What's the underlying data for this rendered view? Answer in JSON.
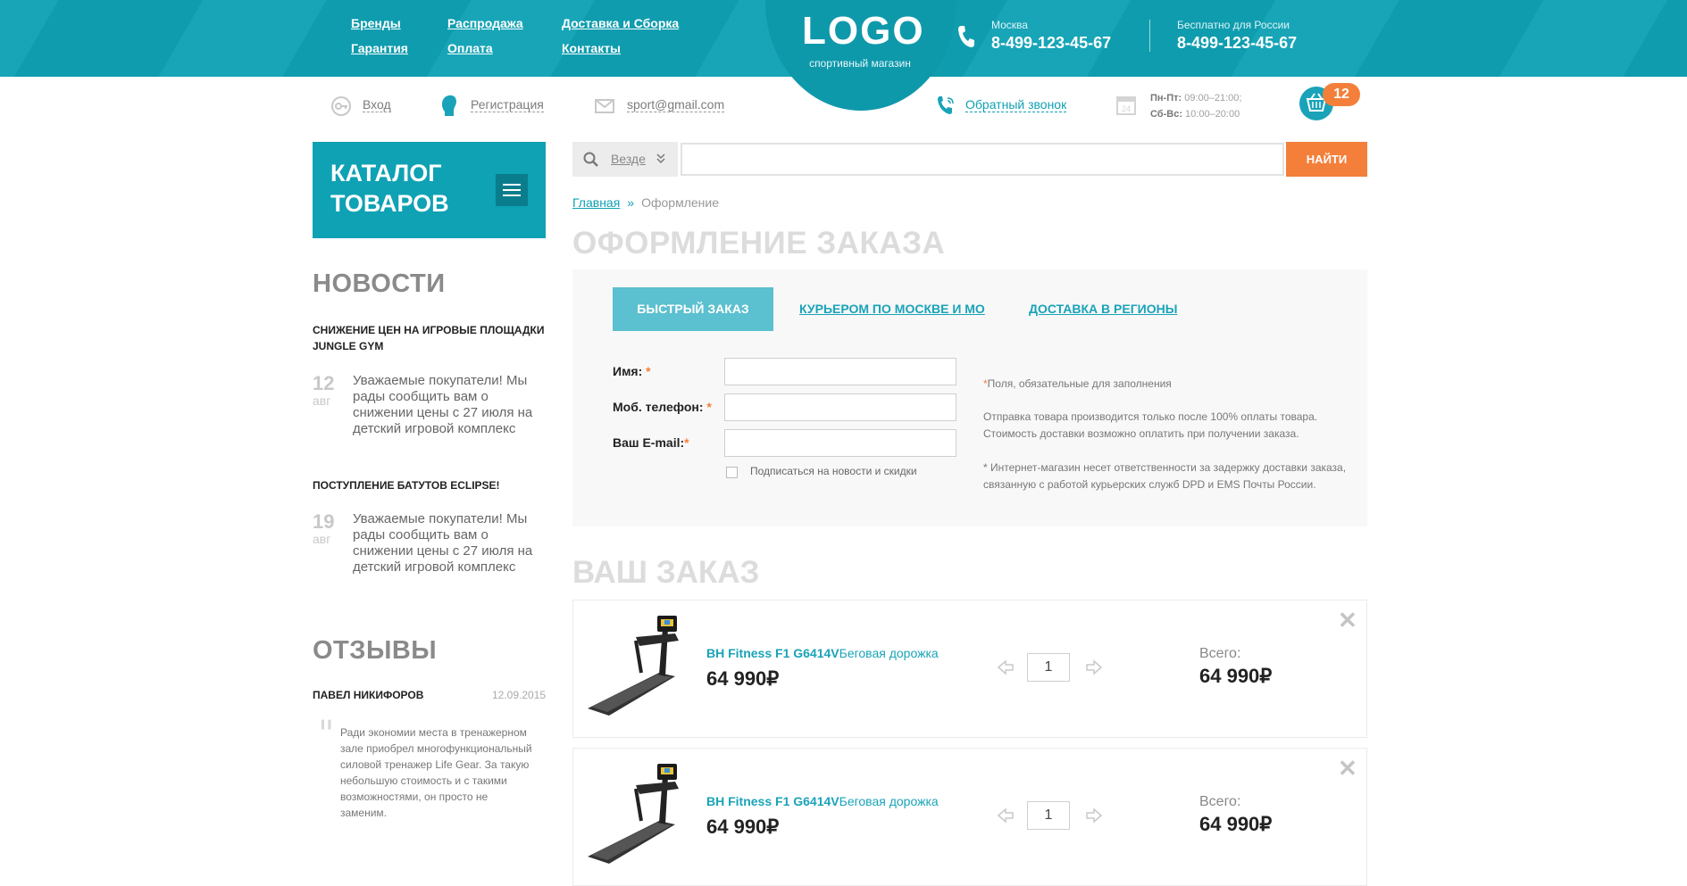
{
  "header": {
    "nav": [
      "Бренды",
      "Распродажа",
      "Доставка и Сборка",
      "Гарантия",
      "Оплата",
      "Контакты"
    ],
    "logo": "LOGO",
    "logo_sub": "спортивный магазин",
    "city1": "Москва",
    "phone1": "8-499-123-45-67",
    "city2": "Бесплатно для России",
    "phone2": "8-499-123-45-67"
  },
  "subheader": {
    "login": "Вход",
    "register": "Регистрация",
    "email": "sport@gmail.com",
    "callback": "Обратный звонок",
    "hours_wd_label": "Пн-Пт:",
    "hours_wd": "09:00–21:00;",
    "hours_we_label": "Сб-Вс:",
    "hours_we": "10:00–20:00",
    "cart_count": "12"
  },
  "catalog": {
    "title": "КАТАЛОГ ТОВАРОВ"
  },
  "sidebar": {
    "news_heading": "НОВОСТИ",
    "news": [
      {
        "title": "СНИЖЕНИЕ ЦЕН НА ИГРОВЫЕ ПЛОЩАДКИ JUNGLE GYM",
        "day": "12",
        "month": "авг",
        "text": "Уважаемые покупатели! Мы рады сообщить вам о снижении цены с 27 июля на детский игровой комплекс"
      },
      {
        "title": "ПОСТУПЛЕНИЕ БАТУТОВ ECLIPSE!",
        "day": "19",
        "month": "авг",
        "text": "Уважаемые покупатели! Мы рады сообщить вам о снижении цены с 27 июля на детский игровой комплекс"
      }
    ],
    "reviews_heading": "ОТЗЫВЫ",
    "review": {
      "name": "ПАВЕЛ НИКИФОРОВ",
      "date": "12.09.2015",
      "text": "Ради экономии места в тренажерном зале приобрел многофункциональный силовой тренажер Life Gear. За такую небольшую стоимость и с такими возможностями, он просто не заменим."
    }
  },
  "search": {
    "scope": "Везде",
    "placeholder": "",
    "button": "НАЙТИ"
  },
  "breadcrumb": {
    "home": "Главная",
    "current": "Оформление"
  },
  "page_title": "ОФОРМЛЕНИЕ ЗАКАЗА",
  "form": {
    "tabs": [
      "БЫСТРЫЙ ЗАКАЗ",
      "КУРЬЕРОМ ПО МОСКВЕ И МО",
      "ДОСТАВКА В РЕГИОНЫ"
    ],
    "active_tab": 0,
    "name_label": "Имя:",
    "phone_label": "Моб. телефон:",
    "email_label": "Ваш E-mail:",
    "req_mark": "*",
    "subscribe": "Подписаться на новости и скидки",
    "subscribe_checked": false,
    "note_required": "Поля, обязательные для заполнения",
    "note_payment": "Отправка товара производится только после 100% оплаты товара. Стоимость доставки возможно оплатить при получении заказа.",
    "note_liability": "* Интернет-магазин несет ответственности за задержку доставки заказа, связанную с работой курьерских служб DPD и EMS Почты России."
  },
  "order": {
    "title": "ВАШ ЗАКАЗ",
    "items": [
      {
        "brand": "BH Fitness F1 G6414V",
        "type": "Беговая дорожка",
        "price": "64 990₽",
        "qty": "1",
        "total_label": "Всего:",
        "total": "64 990₽"
      },
      {
        "brand": "BH Fitness F1 G6414V",
        "type": "Беговая дорожка",
        "price": "64 990₽",
        "qty": "1",
        "total_label": "Всего:",
        "total": "64 990₽"
      }
    ]
  },
  "colors": {
    "teal": "#0fa1b4",
    "orange": "#f47f3a"
  }
}
